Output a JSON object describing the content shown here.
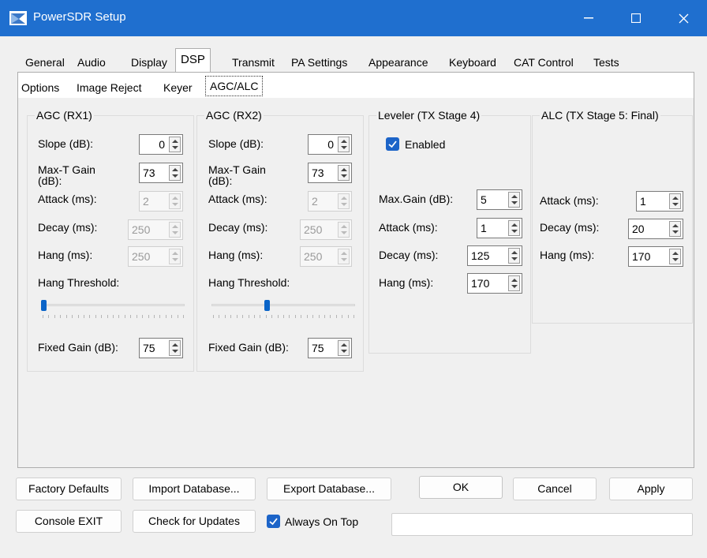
{
  "window": {
    "title": "PowerSDR Setup",
    "icon": "app-icon",
    "controls": {
      "minimize": "minimize-icon",
      "maximize": "maximize-icon",
      "close": "close-icon"
    }
  },
  "main_tabs": [
    "General",
    "Audio",
    "Display",
    "DSP",
    "Transmit",
    "PA Settings",
    "Appearance",
    "Keyboard",
    "CAT Control",
    "Tests"
  ],
  "active_main_tab": "DSP",
  "sub_tabs": [
    "Options",
    "Image Reject",
    "Keyer",
    "AGC/ALC"
  ],
  "active_sub_tab": "AGC/ALC",
  "agc_rx1": {
    "title": "AGC (RX1)",
    "slope_label": "Slope (dB):",
    "slope_value": "0",
    "max_gain_label": "Max-T Gain (dB):",
    "max_gain_value": "73",
    "attack_label": "Attack (ms):",
    "attack_value": "2",
    "decay_label": "Decay (ms):",
    "decay_value": "250",
    "hang_label": "Hang (ms):",
    "hang_value": "250",
    "hang_threshold_label": "Hang Threshold:",
    "hang_threshold_level": 0.0,
    "fixed_gain_label": "Fixed Gain (dB):",
    "fixed_gain_value": "75"
  },
  "agc_rx2": {
    "title": "AGC (RX2)",
    "slope_label": "Slope (dB):",
    "slope_value": "0",
    "max_gain_label": "Max-T Gain (dB):",
    "max_gain_value": "73",
    "attack_label": "Attack (ms):",
    "attack_value": "2",
    "decay_label": "Decay (ms):",
    "decay_value": "250",
    "hang_label": "Hang (ms):",
    "hang_value": "250",
    "hang_threshold_label": "Hang Threshold:",
    "hang_threshold_level": 0.38,
    "fixed_gain_label": "Fixed Gain (dB):",
    "fixed_gain_value": "75"
  },
  "leveler": {
    "title": "Leveler (TX Stage 4)",
    "enabled_label": "Enabled",
    "enabled_checked": true,
    "max_gain_label": "Max.Gain (dB):",
    "max_gain_value": "5",
    "attack_label": "Attack (ms):",
    "attack_value": "1",
    "decay_label": "Decay (ms):",
    "decay_value": "125",
    "hang_label": "Hang (ms):",
    "hang_value": "170"
  },
  "alc": {
    "title": "ALC (TX Stage 5: Final)",
    "attack_label": "Attack (ms):",
    "attack_value": "1",
    "decay_label": "Decay (ms):",
    "decay_value": "20",
    "hang_label": "Hang (ms):",
    "hang_value": "170"
  },
  "buttons": {
    "factory_defaults": "Factory Defaults",
    "import_database": "Import Database...",
    "export_database": "Export Database...",
    "ok": "OK",
    "cancel": "Cancel",
    "apply": "Apply",
    "console_exit": "Console EXIT",
    "check_updates": "Check for Updates"
  },
  "always_on_top": {
    "label": "Always On Top",
    "checked": true
  },
  "status_text": "",
  "colors": {
    "titlebar": "#1f6fcf",
    "accent": "#1c64c8"
  }
}
